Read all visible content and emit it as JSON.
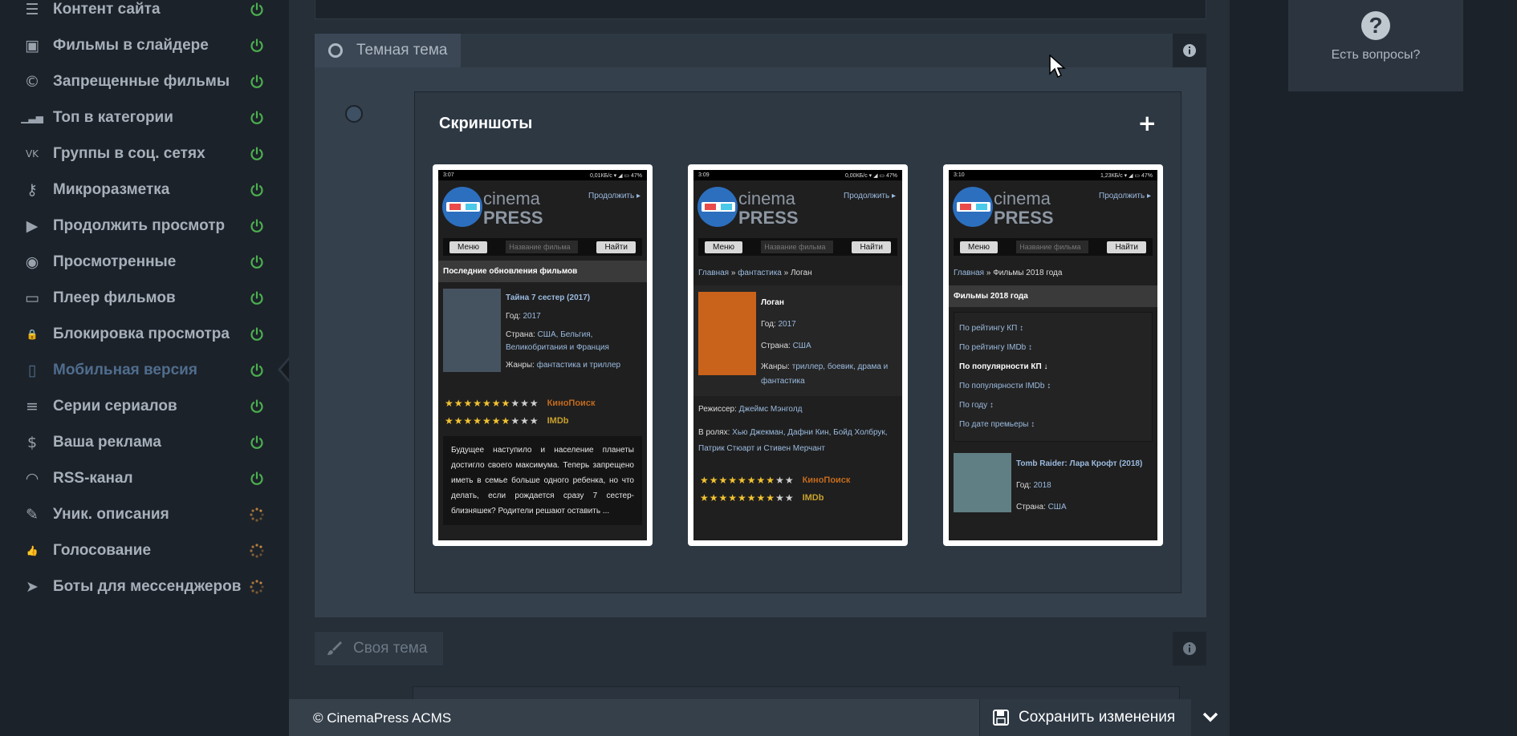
{
  "sidebar": {
    "items": [
      {
        "label": "Контент сайта",
        "icon": "document-icon",
        "glyph": "☰",
        "status": "on"
      },
      {
        "label": "Фильмы в слайдере",
        "icon": "image-icon",
        "glyph": "▣",
        "status": "on"
      },
      {
        "label": "Запрещенные фильмы",
        "icon": "copyright-icon",
        "glyph": "©",
        "status": "on"
      },
      {
        "label": "Топ в категории",
        "icon": "signal-bars-icon",
        "glyph": "▁▃▅",
        "status": "on"
      },
      {
        "label": "Группы в соц. сетях",
        "icon": "vk-icon",
        "glyph": "VK",
        "status": "on"
      },
      {
        "label": "Микроразметка",
        "icon": "key-icon",
        "glyph": "⚷",
        "status": "on"
      },
      {
        "label": "Продолжить просмотр",
        "icon": "play-icon",
        "glyph": "▶",
        "status": "on"
      },
      {
        "label": "Просмотренные",
        "icon": "eye-icon",
        "glyph": "◉",
        "status": "on"
      },
      {
        "label": "Плеер фильмов",
        "icon": "monitor-icon",
        "glyph": "▭",
        "status": "on"
      },
      {
        "label": "Блокировка просмотра",
        "icon": "lock-icon",
        "glyph": "🔒",
        "status": "on"
      },
      {
        "label": "Мобильная версия",
        "icon": "mobile-icon",
        "glyph": "▯",
        "status": "on",
        "active": true
      },
      {
        "label": "Серии сериалов",
        "icon": "list-icon",
        "glyph": "≡",
        "status": "on"
      },
      {
        "label": "Ваша реклама",
        "icon": "money-icon",
        "glyph": "$",
        "status": "on"
      },
      {
        "label": "RSS-канал",
        "icon": "rss-icon",
        "glyph": "◠",
        "status": "on"
      },
      {
        "label": "Уник. описания",
        "icon": "pencil-icon",
        "glyph": "✎",
        "status": "loading"
      },
      {
        "label": "Голосование",
        "icon": "thumbs-up-icon",
        "glyph": "👍",
        "status": "loading"
      },
      {
        "label": "Боты для мессенджеров",
        "icon": "telegram-icon",
        "glyph": "➤",
        "status": "loading"
      }
    ]
  },
  "colors": {
    "power_on": "#4caf50",
    "loading": "#d69045",
    "active_item": "#4f6d8e"
  },
  "theme_panel": {
    "title": "Темная тема",
    "info_icon": "info-icon",
    "screenshots": {
      "title": "Скриншоты",
      "add_label": "+",
      "phones": [
        {
          "time": "3:07",
          "net": "0,01КБ/с  ▾ ◢ ▭ 47%",
          "continue": "Продолжить ▸",
          "menu": "Меню",
          "search_placeholder": "Название фильма",
          "find": "Найти",
          "section": "Последние обновления фильмов",
          "movie_title": "Тайна 7 сестер (2017)",
          "year_label": "Год: ",
          "year": "2017",
          "country_label": "Страна: ",
          "country": "США, Бельгия, Великобритания и Франция",
          "genre_label": "Жанры: ",
          "genres": "фантастика и триллер",
          "kp_label": "КиноПоиск",
          "imdb_label": "IMDb",
          "description": "Будущее наступило и население планеты достигло своего максимума. Теперь запрещено иметь в семье больше одного ребенка, но что делать, если рождается сразу 7 сестер-близняшек? Родители решают оставить ..."
        },
        {
          "time": "3:09",
          "net": "0,00КБ/с  ▾ ◢ ▭ 47%",
          "continue": "Продолжить ▸",
          "menu": "Меню",
          "search_placeholder": "Название фильма",
          "find": "Найти",
          "crumb_home": "Главная",
          "crumb_sep": " » ",
          "crumb_cat": "фантастика",
          "crumb_cur": "Логан",
          "movie_title": "Логан",
          "year_label": "Год: ",
          "year": "2017",
          "country_label": "Страна: ",
          "country": "США",
          "genre_label": "Жанры: ",
          "genres": "триллер, боевик, драма и фантастика",
          "director_label": "Режиссер: ",
          "director": "Джеймс Мэнголд",
          "cast_label": "В ролях: ",
          "cast": "Хью Джекман, Дафни Кин, Бойд Холбрук, Патрик Стюарт и Стивен Мерчант",
          "kp_label": "КиноПоиск",
          "imdb_label": "IMDb"
        },
        {
          "time": "3:10",
          "net": "1,23КБ/с  ▾ ◢ ▭ 47%",
          "continue": "Продолжить ▸",
          "menu": "Меню",
          "search_placeholder": "Название фильма",
          "find": "Найти",
          "crumb_home": "Главная",
          "crumb_sep": " » ",
          "crumb_cur": "Фильмы 2018 года",
          "section": "Фильмы 2018 года",
          "sort": [
            "По рейтингу КП ↕",
            "По рейтингу IMDb ↕",
            "По популярности КП ↓",
            "По популярности IMDb ↕",
            "По году ↕",
            "По дате премьеры ↕"
          ],
          "movie_title": "Tomb Raider: Лара Крофт (2018)",
          "year_label": "Год: ",
          "year": "2018",
          "country_label": "Страна: ",
          "country": "США"
        }
      ]
    }
  },
  "own_theme": {
    "title": "Своя тема"
  },
  "footer": {
    "copyright": "© CinemaPress ACMS",
    "save_label": "Сохранить изменения"
  },
  "help": {
    "label": "Есть вопросы?"
  }
}
